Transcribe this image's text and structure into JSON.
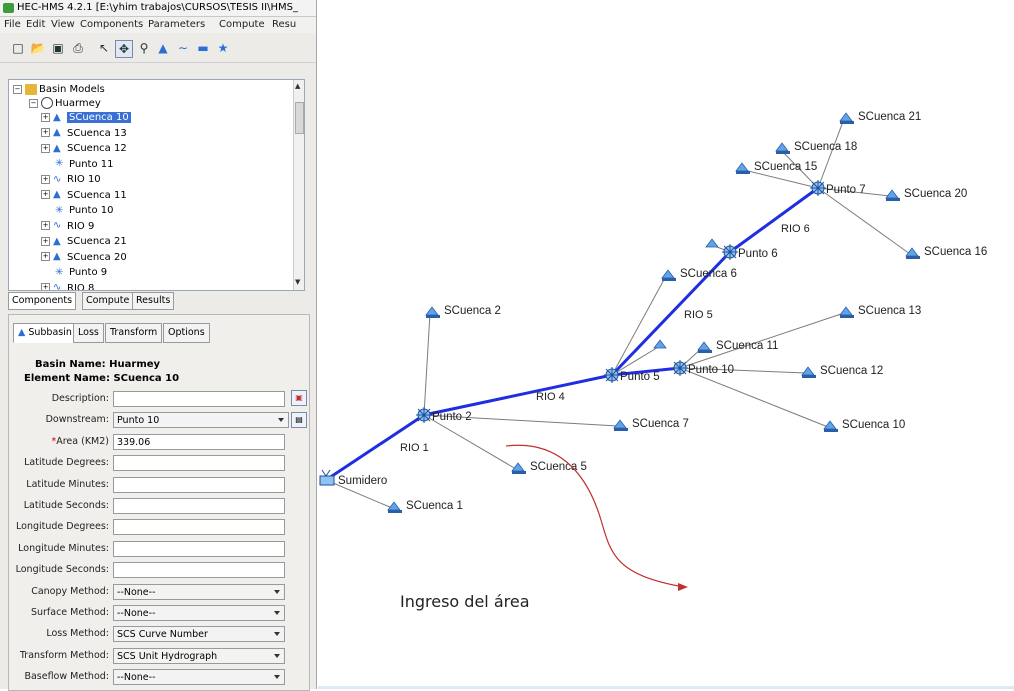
{
  "window": {
    "title": "HEC-HMS 4.2.1 [E:\\yhim trabajos\\CURSOS\\TESIS II\\HMS_"
  },
  "menu": [
    "File",
    "Edit",
    "View",
    "Components",
    "Parameters",
    "Compute",
    "Resu"
  ],
  "toolbar": {
    "icons": [
      "new-icon",
      "open-icon",
      "save-icon",
      "print-icon",
      "arrow-icon",
      "move-icon",
      "zoom-icon",
      "subbasin-tool-icon",
      "reach-tool-icon",
      "reservoir-tool-icon",
      "junction-tool-icon"
    ]
  },
  "tree": {
    "root": "Basin Models",
    "basin": "Huarmey",
    "items": [
      {
        "label": "SCuenca 10",
        "type": "subbasin",
        "expandable": true,
        "selected": true
      },
      {
        "label": "SCuenca 13",
        "type": "subbasin",
        "expandable": true,
        "selected": false
      },
      {
        "label": "SCuenca 12",
        "type": "subbasin",
        "expandable": true,
        "selected": false
      },
      {
        "label": "Punto 11",
        "type": "junction",
        "expandable": false,
        "selected": false
      },
      {
        "label": "RIO 10",
        "type": "reach",
        "expandable": true,
        "selected": false
      },
      {
        "label": "SCuenca 11",
        "type": "subbasin",
        "expandable": true,
        "selected": false
      },
      {
        "label": "Punto 10",
        "type": "junction",
        "expandable": false,
        "selected": false
      },
      {
        "label": "RIO 9",
        "type": "reach",
        "expandable": true,
        "selected": false
      },
      {
        "label": "SCuenca 21",
        "type": "subbasin",
        "expandable": true,
        "selected": false
      },
      {
        "label": "SCuenca 20",
        "type": "subbasin",
        "expandable": true,
        "selected": false
      },
      {
        "label": "Punto 9",
        "type": "junction",
        "expandable": false,
        "selected": false
      },
      {
        "label": "RIO 8",
        "type": "reach",
        "expandable": true,
        "selected": false
      }
    ]
  },
  "component_tabs": [
    "Components",
    "Compute",
    "Results"
  ],
  "editor": {
    "tabs": [
      "Subbasin",
      "Loss",
      "Transform",
      "Options"
    ],
    "basin_name_label": "Basin Name:",
    "basin_name": "Huarmey",
    "element_name_label": "Element Name:",
    "element_name": "SCuenca 10",
    "fields": [
      {
        "label": "Description:",
        "value": "",
        "kind": "text",
        "required": false
      },
      {
        "label": "Downstream:",
        "value": "Punto 10",
        "kind": "select",
        "required": false
      },
      {
        "label": "Area (KM2)",
        "value": "339.06",
        "kind": "text",
        "required": true
      },
      {
        "label": "Latitude Degrees:",
        "value": "",
        "kind": "text",
        "required": false
      },
      {
        "label": "Latitude Minutes:",
        "value": "",
        "kind": "text",
        "required": false
      },
      {
        "label": "Latitude Seconds:",
        "value": "",
        "kind": "text",
        "required": false
      },
      {
        "label": "Longitude Degrees:",
        "value": "",
        "kind": "text",
        "required": false
      },
      {
        "label": "Longitude Minutes:",
        "value": "",
        "kind": "text",
        "required": false
      },
      {
        "label": "Longitude Seconds:",
        "value": "",
        "kind": "text",
        "required": false
      },
      {
        "label": "Canopy Method:",
        "value": "--None--",
        "kind": "select",
        "required": false
      },
      {
        "label": "Surface Method:",
        "value": "--None--",
        "kind": "select",
        "required": false
      },
      {
        "label": "Loss Method:",
        "value": "SCS Curve Number",
        "kind": "select",
        "required": false
      },
      {
        "label": "Transform Method:",
        "value": "SCS Unit Hydrograph",
        "kind": "select",
        "required": false
      },
      {
        "label": "Baseflow Method:",
        "value": "--None--",
        "kind": "select",
        "required": false
      }
    ],
    "required_marker": "*"
  },
  "map": {
    "subbasins": [
      "SCuenca 21",
      "SCuenca 18",
      "SCuenca 15",
      "SCuenca 20",
      "SCuenca 16",
      "SCuenca 6",
      "SCuenca 2",
      "SCuenca 13",
      "SCuenca 11",
      "SCuenca 12",
      "SCuenca 7",
      "SCuenca 10",
      "SCuenca 5",
      "SCuenca 1"
    ],
    "junctions": [
      "Punto 7",
      "Punto 6",
      "Punto 5",
      "Punto 10",
      "Punto 2"
    ],
    "reaches": [
      "RIO 6",
      "RIO 5",
      "RIO 4",
      "RIO 1"
    ],
    "sink": "Sumidero",
    "colors": {
      "reach": "#1f2ee0",
      "connector": "#7c7c7c",
      "annotation_arrow": "#c03030"
    }
  },
  "annotation": "Ingreso del área"
}
